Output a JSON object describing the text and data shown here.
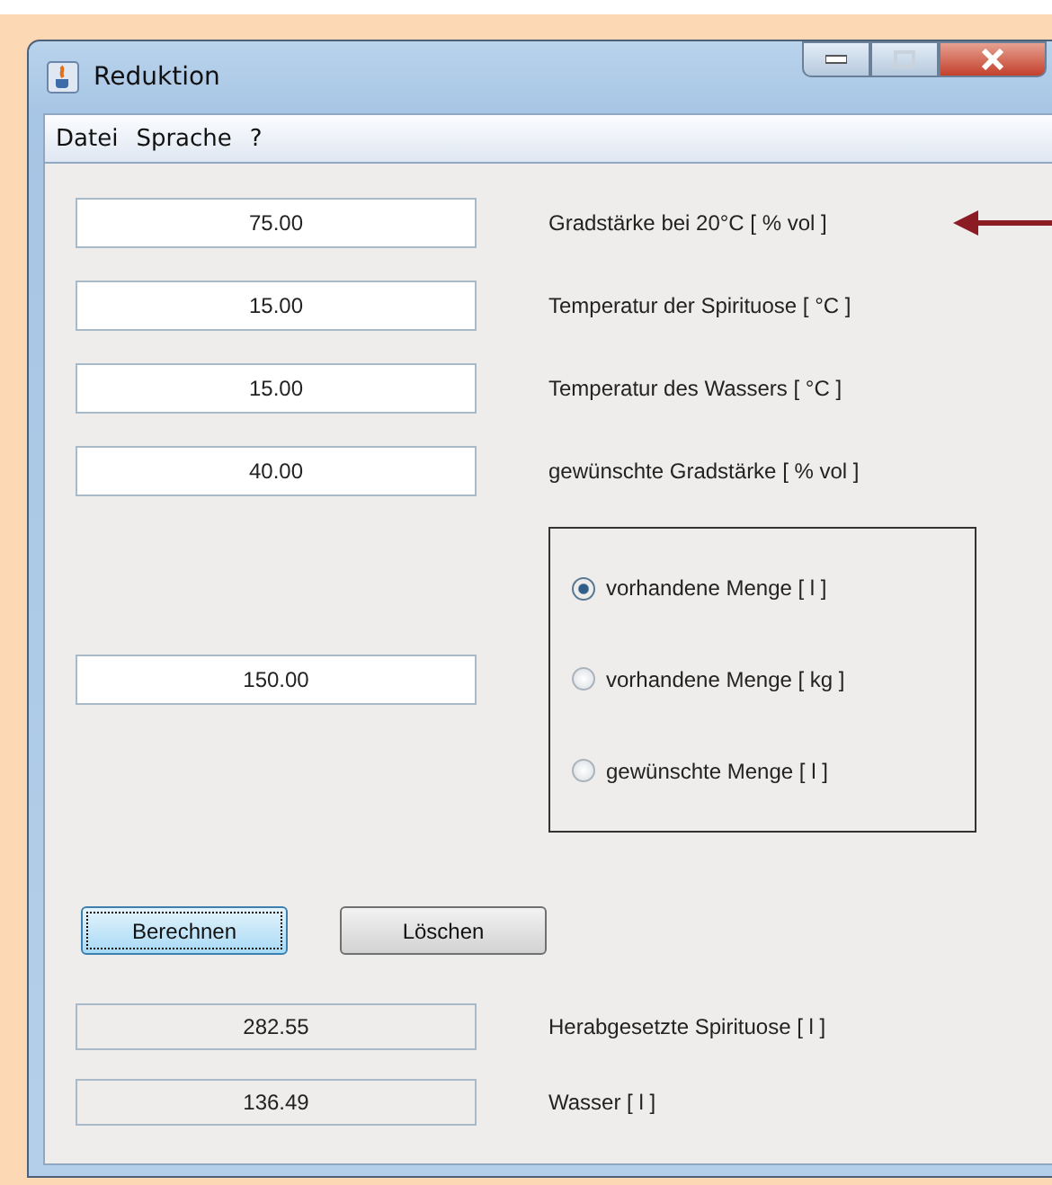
{
  "window": {
    "title": "Reduktion"
  },
  "menu": [
    "Datei",
    "Sprache",
    "?"
  ],
  "inputs": [
    {
      "value": "75.00",
      "label": "Gradstärke bei 20°C [ % vol ]",
      "arrow": true
    },
    {
      "value": "15.00",
      "label": "Temperatur der Spirituose [ °C ]",
      "arrow": false
    },
    {
      "value": "15.00",
      "label": "Temperatur des Wassers [ °C ]",
      "arrow": false
    },
    {
      "value": "40.00",
      "label": "gewünschte Gradstärke [ % vol ]",
      "arrow": false
    }
  ],
  "quantity": {
    "value": "150.00"
  },
  "radios": [
    {
      "label": "vorhandene Menge [ l ]",
      "selected": true
    },
    {
      "label": "vorhandene Menge [ kg ]",
      "selected": false
    },
    {
      "label": "gewünschte Menge [ l ]",
      "selected": false
    }
  ],
  "buttons": [
    {
      "label": "Berechnen",
      "focused": true
    },
    {
      "label": "Löschen",
      "focused": false
    }
  ],
  "results": [
    {
      "value": "282.55",
      "label": "Herabgesetzte Spirituose [ l ]"
    },
    {
      "value": "136.49",
      "label": "Wasser [ l ]"
    }
  ]
}
